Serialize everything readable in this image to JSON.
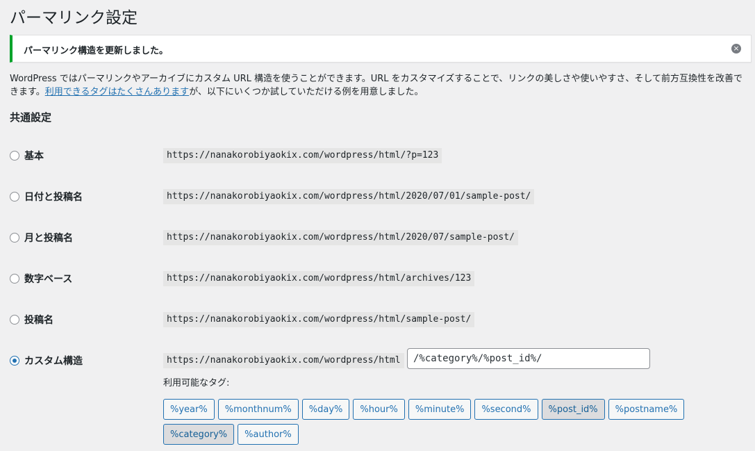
{
  "page_title": "パーマリンク設定",
  "notice": {
    "message": "パーマリンク構造を更新しました。",
    "dismiss_icon": "×"
  },
  "description": {
    "text_before": "WordPress ではパーマリンクやアーカイブにカスタム URL 構造を使うことができます。URL をカスタマイズすることで、リンクの美しさや使いやすさ、そして前方互換性を改善できます。",
    "link": "利用できるタグはたくさんあります",
    "text_after": "が、以下にいくつか試していただける例を用意しました。"
  },
  "section_title": "共通設定",
  "options": [
    {
      "label": "基本",
      "example": "https://nanakorobiyaokix.com/wordpress/html/?p=123",
      "checked": false
    },
    {
      "label": "日付と投稿名",
      "example": "https://nanakorobiyaokix.com/wordpress/html/2020/07/01/sample-post/",
      "checked": false
    },
    {
      "label": "月と投稿名",
      "example": "https://nanakorobiyaokix.com/wordpress/html/2020/07/sample-post/",
      "checked": false
    },
    {
      "label": "数字ベース",
      "example": "https://nanakorobiyaokix.com/wordpress/html/archives/123",
      "checked": false
    },
    {
      "label": "投稿名",
      "example": "https://nanakorobiyaokix.com/wordpress/html/sample-post/",
      "checked": false
    },
    {
      "label": "カスタム構造",
      "example": "https://nanakorobiyaokix.com/wordpress/html",
      "checked": true
    }
  ],
  "custom_structure_value": "/%category%/%post_id%/",
  "available_tags_label": "利用可能なタグ:",
  "tags": [
    {
      "label": "%year%",
      "active": false
    },
    {
      "label": "%monthnum%",
      "active": false
    },
    {
      "label": "%day%",
      "active": false
    },
    {
      "label": "%hour%",
      "active": false
    },
    {
      "label": "%minute%",
      "active": false
    },
    {
      "label": "%second%",
      "active": false
    },
    {
      "label": "%post_id%",
      "active": true
    },
    {
      "label": "%postname%",
      "active": false
    },
    {
      "label": "%category%",
      "active": true
    },
    {
      "label": "%author%",
      "active": false
    }
  ],
  "colors": {
    "accent": "#2271b1",
    "success": "#00a32a",
    "background": "#f0f0f1"
  }
}
